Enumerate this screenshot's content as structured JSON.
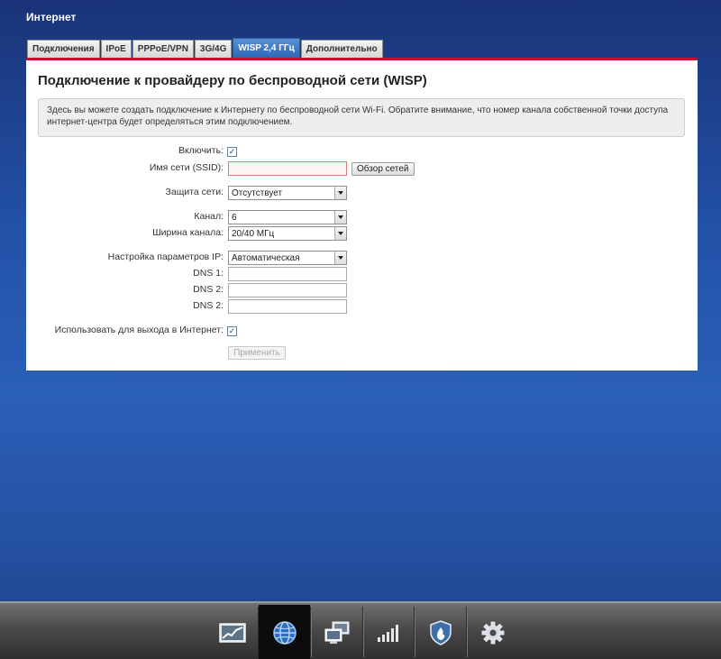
{
  "page": {
    "heading": "Интернет"
  },
  "tabs": [
    {
      "label": "Подключения",
      "active": false
    },
    {
      "label": "IPoE",
      "active": false
    },
    {
      "label": "PPPoE/VPN",
      "active": false
    },
    {
      "label": "3G/4G",
      "active": false
    },
    {
      "label": "WISP 2,4 ГГц",
      "active": true
    },
    {
      "label": "Дополнительно",
      "active": false
    }
  ],
  "panel": {
    "title": "Подключение к провайдеру по беспроводной сети (WISP)",
    "info_line1": "Здесь вы можете создать подключение к Интернету по беспроводной сети Wi-Fi. Обратите внимание, что номер канала собственной точки доступа",
    "info_line2": "интернет-центра будет определяться этим подключением."
  },
  "form": {
    "enable": {
      "label": "Включить:",
      "checked": true
    },
    "ssid": {
      "label": "Имя сети (SSID):",
      "value": "",
      "scan_button": "Обзор сетей"
    },
    "security": {
      "label": "Защита сети:",
      "value": "Отсутствует"
    },
    "channel": {
      "label": "Канал:",
      "value": "6"
    },
    "channel_width": {
      "label": "Ширина канала:",
      "value": "20/40 МГц"
    },
    "ip_settings": {
      "label": "Настройка параметров IP:",
      "value": "Автоматическая"
    },
    "dns1": {
      "label": "DNS 1:",
      "value": ""
    },
    "dns2": {
      "label": "DNS 2:",
      "value": ""
    },
    "dns3": {
      "label": "DNS 2:",
      "value": ""
    },
    "use_for_internet": {
      "label": "Использовать для выхода в Интернет:",
      "checked": true
    },
    "apply_button": "Применить"
  },
  "bottom_nav": [
    {
      "icon": "monitor-chart-icon",
      "active": false
    },
    {
      "icon": "globe-icon",
      "active": true
    },
    {
      "icon": "network-computers-icon",
      "active": false
    },
    {
      "icon": "signal-bars-icon",
      "active": false
    },
    {
      "icon": "shield-icon",
      "active": false
    },
    {
      "icon": "gear-icon",
      "active": false
    }
  ],
  "colors": {
    "accent_red": "#c8102e",
    "tab_active": "#3b74c4",
    "background_blue": "#2352a8"
  }
}
